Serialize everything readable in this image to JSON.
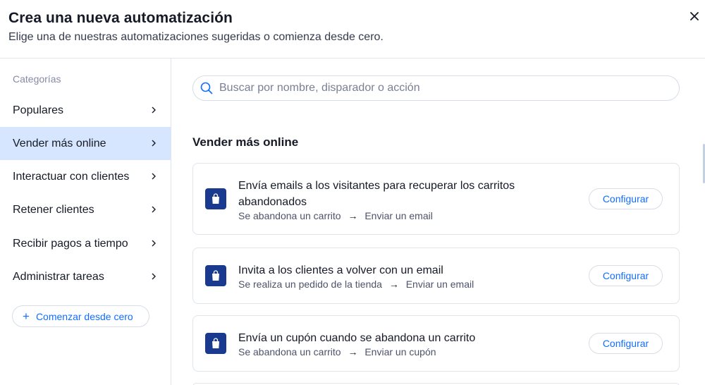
{
  "header": {
    "title": "Crea una nueva automatización",
    "subtitle": "Elige una de nuestras automatizaciones sugeridas o comienza desde cero."
  },
  "sidebar": {
    "heading": "Categorías",
    "items": [
      {
        "label": "Populares"
      },
      {
        "label": "Vender más online",
        "active": true
      },
      {
        "label": "Interactuar con clientes"
      },
      {
        "label": "Retener clientes"
      },
      {
        "label": "Recibir pagos a tiempo"
      },
      {
        "label": "Administrar tareas"
      }
    ],
    "start_button": "Comenzar desde cero"
  },
  "search": {
    "placeholder": "Buscar por nombre, disparador o acción"
  },
  "main": {
    "section_title": "Vender más online",
    "cards": [
      {
        "title": "Envía emails a los visitantes para recuperar los carritos abandonados",
        "trigger": "Se abandona un carrito",
        "arrow": "→",
        "action": "Enviar un email",
        "button": "Configurar"
      },
      {
        "title": "Invita a los clientes a volver con un email",
        "trigger": "Se realiza un pedido de la tienda",
        "arrow": "→",
        "action": "Enviar un email",
        "button": "Configurar"
      },
      {
        "title": "Envía un cupón cuando se abandona un carrito",
        "trigger": "Se abandona un carrito",
        "arrow": "→",
        "action": "Enviar un cupón",
        "button": "Configurar"
      }
    ]
  },
  "colors": {
    "accent": "#116dff",
    "active_bg": "#d6e6fe",
    "icon_bg": "#1a3a8f",
    "border": "#dfe5eb"
  },
  "icons": {
    "close": "close-icon",
    "search": "search-icon",
    "chevron": "chevron-right-icon",
    "plus": "plus-icon",
    "bag": "shopping-bag-icon"
  }
}
